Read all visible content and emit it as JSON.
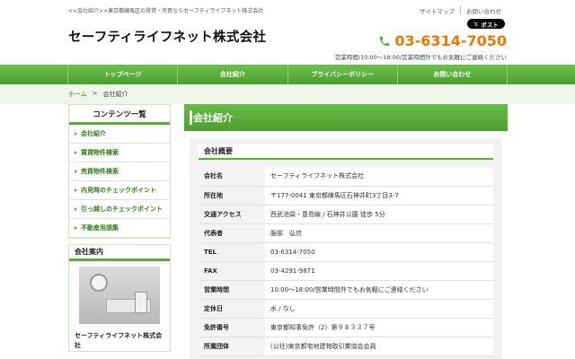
{
  "header": {
    "tagline": "<<会社紹介>>東京都練馬区の賃貸・売買ならセーフティライフネット株式会社",
    "sitemap": "サイトマップ",
    "contact": "お問い合わせ",
    "logo": "セーフティライフネット株式会社",
    "post_label": "ポスト",
    "phone": "03-6314-7050",
    "hours": "営業時間/10:00～18:00/営業時間外でもお気軽にご連絡ください"
  },
  "nav": [
    "トップページ",
    "会社紹介",
    "プライバシーポリシー",
    "お問い合わせ"
  ],
  "breadcrumb": {
    "home": "ホーム",
    "arrow": ">",
    "current": "会社紹介"
  },
  "sidebar": {
    "title": "コンテンツ一覧",
    "items": [
      "会社紹介",
      "賃貸物件検索",
      "売買物件検索",
      "内見時のチェックポイント",
      "引っ越しのチェックポイント",
      "不動産用語集"
    ],
    "info_title": "会社案内",
    "info_name": "セーフティライフネット株式会社"
  },
  "main": {
    "title": "会社紹介",
    "section_title": "会社概要",
    "rows": [
      {
        "key": "会社名",
        "value": "セーフティライフネット株式会社"
      },
      {
        "key": "所在地",
        "value": "〒177-0041 東京都練馬区石神井町3丁目3-7"
      },
      {
        "key": "交通アクセス",
        "value": "西武池袋・豊島線 / 石神井公園 徒歩 5分"
      },
      {
        "key": "代表者",
        "value": "服部　弘信"
      },
      {
        "key": "TEL",
        "value": "03-6314-7050"
      },
      {
        "key": "FAX",
        "value": "03-4291-9871"
      },
      {
        "key": "営業時間",
        "value": "10:00～18:00/営業時間外でもお気軽にご連絡ください"
      },
      {
        "key": "定休日",
        "value": "水 / なし"
      },
      {
        "key": "免許番号",
        "value": "東京都知事免許（2）第９８３３７号"
      },
      {
        "key": "所属団体",
        "value": "(公社)東京都宅地建物取引業協会会員"
      }
    ]
  },
  "colors": {
    "accent": "#5aae36",
    "phone": "#f07800"
  }
}
